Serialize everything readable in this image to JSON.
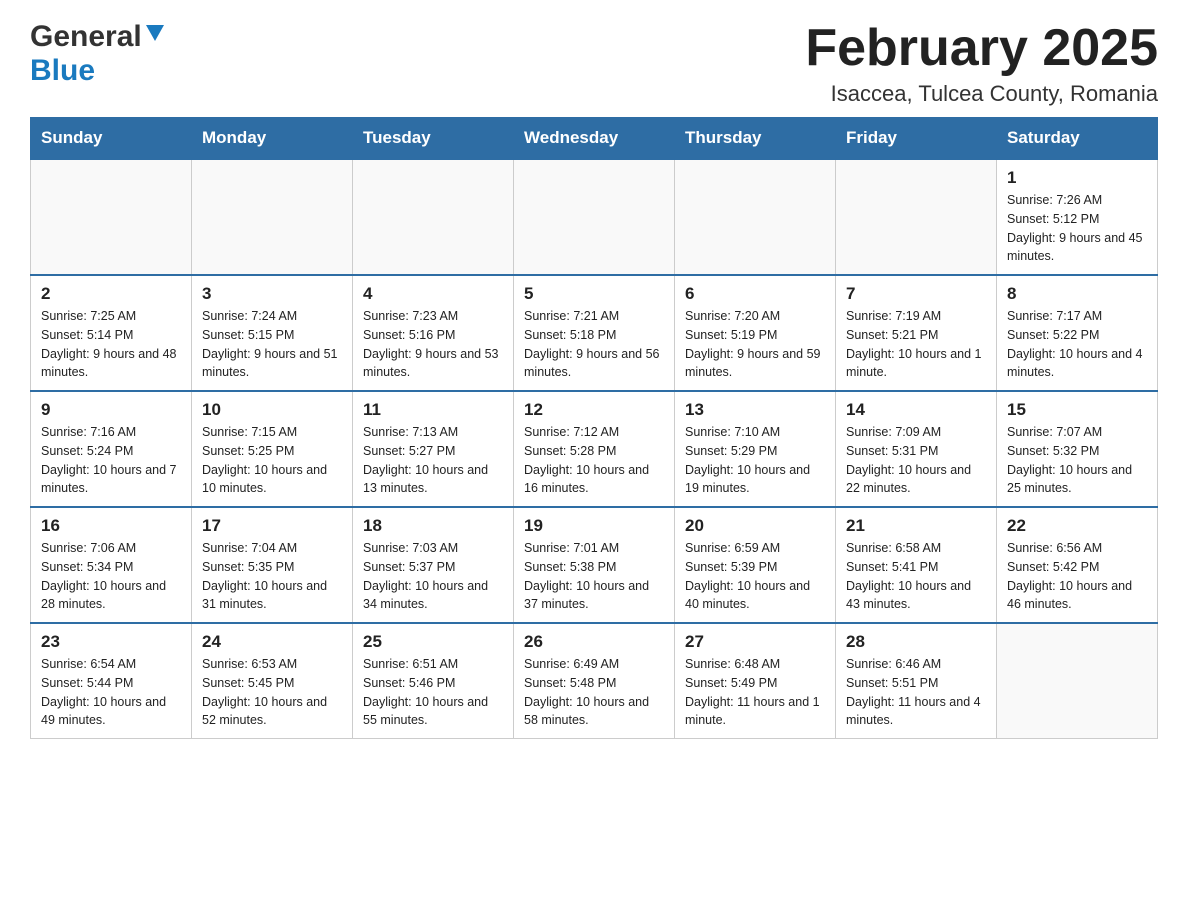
{
  "header": {
    "logo_general": "General",
    "logo_blue": "Blue",
    "month_year": "February 2025",
    "location": "Isaccea, Tulcea County, Romania"
  },
  "weekdays": [
    "Sunday",
    "Monday",
    "Tuesday",
    "Wednesday",
    "Thursday",
    "Friday",
    "Saturday"
  ],
  "weeks": [
    [
      {
        "day": "",
        "info": ""
      },
      {
        "day": "",
        "info": ""
      },
      {
        "day": "",
        "info": ""
      },
      {
        "day": "",
        "info": ""
      },
      {
        "day": "",
        "info": ""
      },
      {
        "day": "",
        "info": ""
      },
      {
        "day": "1",
        "info": "Sunrise: 7:26 AM\nSunset: 5:12 PM\nDaylight: 9 hours and 45 minutes."
      }
    ],
    [
      {
        "day": "2",
        "info": "Sunrise: 7:25 AM\nSunset: 5:14 PM\nDaylight: 9 hours and 48 minutes."
      },
      {
        "day": "3",
        "info": "Sunrise: 7:24 AM\nSunset: 5:15 PM\nDaylight: 9 hours and 51 minutes."
      },
      {
        "day": "4",
        "info": "Sunrise: 7:23 AM\nSunset: 5:16 PM\nDaylight: 9 hours and 53 minutes."
      },
      {
        "day": "5",
        "info": "Sunrise: 7:21 AM\nSunset: 5:18 PM\nDaylight: 9 hours and 56 minutes."
      },
      {
        "day": "6",
        "info": "Sunrise: 7:20 AM\nSunset: 5:19 PM\nDaylight: 9 hours and 59 minutes."
      },
      {
        "day": "7",
        "info": "Sunrise: 7:19 AM\nSunset: 5:21 PM\nDaylight: 10 hours and 1 minute."
      },
      {
        "day": "8",
        "info": "Sunrise: 7:17 AM\nSunset: 5:22 PM\nDaylight: 10 hours and 4 minutes."
      }
    ],
    [
      {
        "day": "9",
        "info": "Sunrise: 7:16 AM\nSunset: 5:24 PM\nDaylight: 10 hours and 7 minutes."
      },
      {
        "day": "10",
        "info": "Sunrise: 7:15 AM\nSunset: 5:25 PM\nDaylight: 10 hours and 10 minutes."
      },
      {
        "day": "11",
        "info": "Sunrise: 7:13 AM\nSunset: 5:27 PM\nDaylight: 10 hours and 13 minutes."
      },
      {
        "day": "12",
        "info": "Sunrise: 7:12 AM\nSunset: 5:28 PM\nDaylight: 10 hours and 16 minutes."
      },
      {
        "day": "13",
        "info": "Sunrise: 7:10 AM\nSunset: 5:29 PM\nDaylight: 10 hours and 19 minutes."
      },
      {
        "day": "14",
        "info": "Sunrise: 7:09 AM\nSunset: 5:31 PM\nDaylight: 10 hours and 22 minutes."
      },
      {
        "day": "15",
        "info": "Sunrise: 7:07 AM\nSunset: 5:32 PM\nDaylight: 10 hours and 25 minutes."
      }
    ],
    [
      {
        "day": "16",
        "info": "Sunrise: 7:06 AM\nSunset: 5:34 PM\nDaylight: 10 hours and 28 minutes."
      },
      {
        "day": "17",
        "info": "Sunrise: 7:04 AM\nSunset: 5:35 PM\nDaylight: 10 hours and 31 minutes."
      },
      {
        "day": "18",
        "info": "Sunrise: 7:03 AM\nSunset: 5:37 PM\nDaylight: 10 hours and 34 minutes."
      },
      {
        "day": "19",
        "info": "Sunrise: 7:01 AM\nSunset: 5:38 PM\nDaylight: 10 hours and 37 minutes."
      },
      {
        "day": "20",
        "info": "Sunrise: 6:59 AM\nSunset: 5:39 PM\nDaylight: 10 hours and 40 minutes."
      },
      {
        "day": "21",
        "info": "Sunrise: 6:58 AM\nSunset: 5:41 PM\nDaylight: 10 hours and 43 minutes."
      },
      {
        "day": "22",
        "info": "Sunrise: 6:56 AM\nSunset: 5:42 PM\nDaylight: 10 hours and 46 minutes."
      }
    ],
    [
      {
        "day": "23",
        "info": "Sunrise: 6:54 AM\nSunset: 5:44 PM\nDaylight: 10 hours and 49 minutes."
      },
      {
        "day": "24",
        "info": "Sunrise: 6:53 AM\nSunset: 5:45 PM\nDaylight: 10 hours and 52 minutes."
      },
      {
        "day": "25",
        "info": "Sunrise: 6:51 AM\nSunset: 5:46 PM\nDaylight: 10 hours and 55 minutes."
      },
      {
        "day": "26",
        "info": "Sunrise: 6:49 AM\nSunset: 5:48 PM\nDaylight: 10 hours and 58 minutes."
      },
      {
        "day": "27",
        "info": "Sunrise: 6:48 AM\nSunset: 5:49 PM\nDaylight: 11 hours and 1 minute."
      },
      {
        "day": "28",
        "info": "Sunrise: 6:46 AM\nSunset: 5:51 PM\nDaylight: 11 hours and 4 minutes."
      },
      {
        "day": "",
        "info": ""
      }
    ]
  ]
}
